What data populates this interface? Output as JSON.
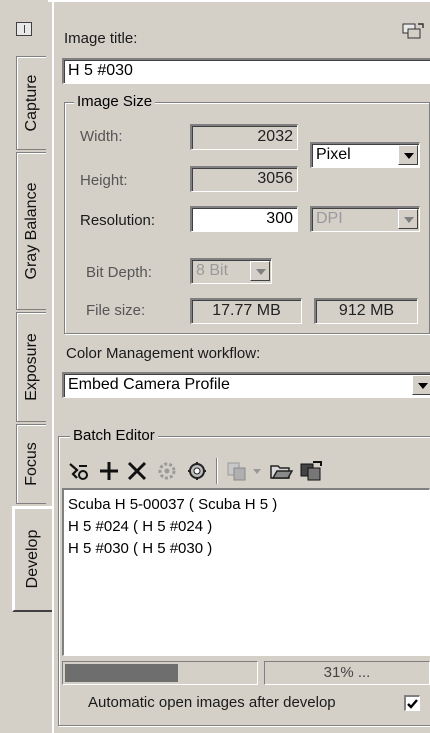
{
  "tabs": [
    {
      "label": "Capture",
      "active": false
    },
    {
      "label": "Gray Balance",
      "active": false
    },
    {
      "label": "Exposure",
      "active": false
    },
    {
      "label": "Focus",
      "active": false
    },
    {
      "label": "Develop",
      "active": true
    }
  ],
  "image_title": {
    "label": "Image title:",
    "value": "H 5 #030"
  },
  "image_size": {
    "group_title": "Image Size",
    "width_label": "Width:",
    "width_value": "2032",
    "height_label": "Height:",
    "height_value": "3056",
    "unit_value": "Pixel",
    "resolution_label": "Resolution:",
    "resolution_value": "300",
    "resolution_unit": "DPI",
    "bit_depth_label": "Bit Depth:",
    "bit_depth_value": "8 Bit",
    "file_size_label": "File size:",
    "file_size_value": "17.77 MB",
    "file_size_value2": "912 MB"
  },
  "color_management": {
    "label": "Color Management workflow:",
    "value": "Embed Camera Profile"
  },
  "batch_editor": {
    "group_title": "Batch Editor",
    "items": [
      "Scuba H 5-00037 ( Scuba H 5 )",
      "H 5 #024 ( H 5 #024 )",
      "H 5 #030 ( H 5 #030 )"
    ],
    "progress_percent": 31,
    "progress_text": "31% ...",
    "auto_open_label": "Automatic open images after develop",
    "auto_open_checked": true
  },
  "colors": {
    "face": "#d4d0c8",
    "shadow": "#808080",
    "highlight": "#ffffff",
    "progress_fill": "#6e6e6e"
  }
}
